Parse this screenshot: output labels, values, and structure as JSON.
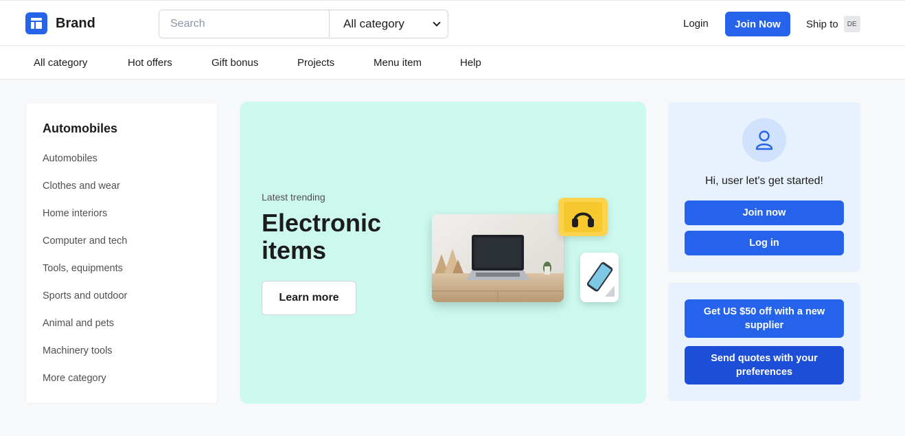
{
  "header": {
    "brand": "Brand",
    "search": {
      "placeholder": "Search"
    },
    "category_select": "All category",
    "login": "Login",
    "join": "Join Now",
    "ship_to": "Ship to",
    "country": "DE"
  },
  "nav": {
    "items": [
      "All category",
      "Hot offers",
      "Gift bonus",
      "Projects",
      "Menu item",
      "Help"
    ]
  },
  "sidebar": {
    "title": "Automobiles",
    "items": [
      "Automobiles",
      "Clothes and wear",
      "Home interiors",
      "Computer and tech",
      "Tools, equipments",
      "Sports and outdoor",
      "Animal and pets",
      "Machinery tools",
      "More category"
    ]
  },
  "hero": {
    "subtitle": "Latest trending",
    "title": "Electronic items",
    "cta": "Learn more"
  },
  "user_card": {
    "greeting": "Hi, user let's get started!",
    "join": "Join now",
    "login": "Log in"
  },
  "promo": {
    "offer": "Get US $50 off with a new supplier",
    "quotes": "Send quotes with your preferences"
  },
  "colors": {
    "primary": "#2563eb",
    "primary_dark": "#1d4ed8",
    "hero_bg": "#ccf8ee",
    "card_bg": "#e8f1fe"
  }
}
